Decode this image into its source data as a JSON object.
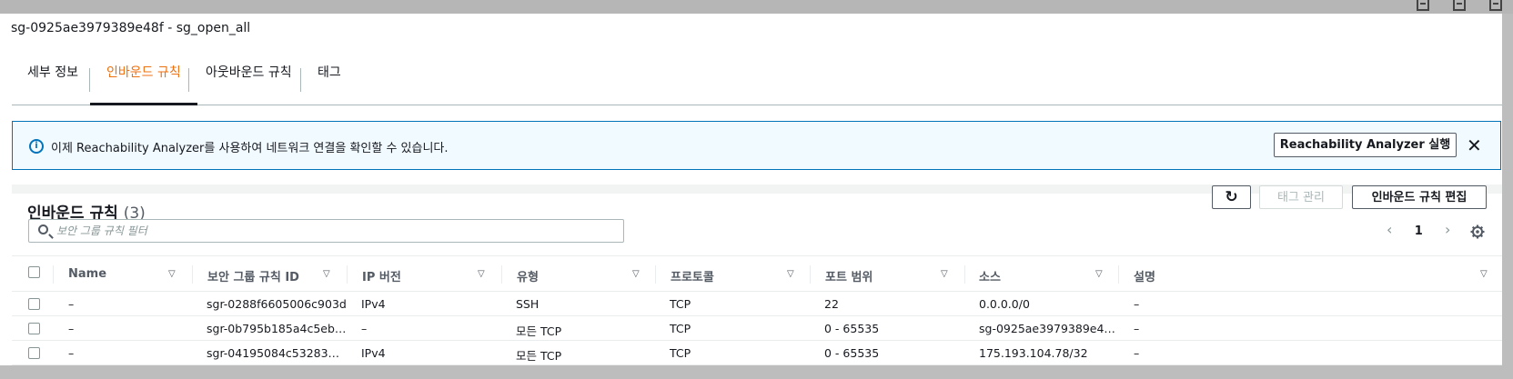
{
  "window_title": "sg-0925ae3979389e48f - sg_open_all",
  "tabs": [
    {
      "label": "세부 정보",
      "active": false
    },
    {
      "label": "인바운드 규칙",
      "active": true
    },
    {
      "label": "아웃바운드 규칙",
      "active": false
    },
    {
      "label": "태그",
      "active": false
    }
  ],
  "alert": {
    "text": "이제 Reachability Analyzer를 사용하여 네트워크 연결을 확인할 수 있습니다.",
    "button_label": "Reachability Analyzer 실행",
    "close_glyph": "✕"
  },
  "section": {
    "title": "인바운드 규칙",
    "count": "(3)",
    "refresh_glyph": "↻",
    "tag_manage_label": "태그 관리",
    "edit_button_label": "인바운드 규칙 편집",
    "search_placeholder": "보안 그룹 규칙 필터"
  },
  "pagination": {
    "prev_glyph": "‹",
    "page": "1",
    "next_glyph": "›"
  },
  "table": {
    "columns": [
      "Name",
      "보안 그룹 규칙 ID",
      "IP 버전",
      "유형",
      "프로토콜",
      "포트 범위",
      "소스",
      "설명"
    ],
    "sort_glyph": "▽",
    "rows": [
      [
        "–",
        "sgr-0288f6605006c903d",
        "IPv4",
        "SSH",
        "TCP",
        "22",
        "0.0.0.0/0",
        "–"
      ],
      [
        "–",
        "sgr-0b795b185a4c5eb…",
        "–",
        "모든 TCP",
        "TCP",
        "0 - 65535",
        "sg-0925ae3979389e4…",
        "–"
      ],
      [
        "–",
        "sgr-04195084c53283…",
        "IPv4",
        "모든 TCP",
        "TCP",
        "0 - 65535",
        "175.193.104.78/32",
        "–"
      ]
    ]
  },
  "colors": {
    "accent_orange": "#ec7211",
    "info_blue": "#0073bb",
    "info_bg": "#f1faff"
  }
}
